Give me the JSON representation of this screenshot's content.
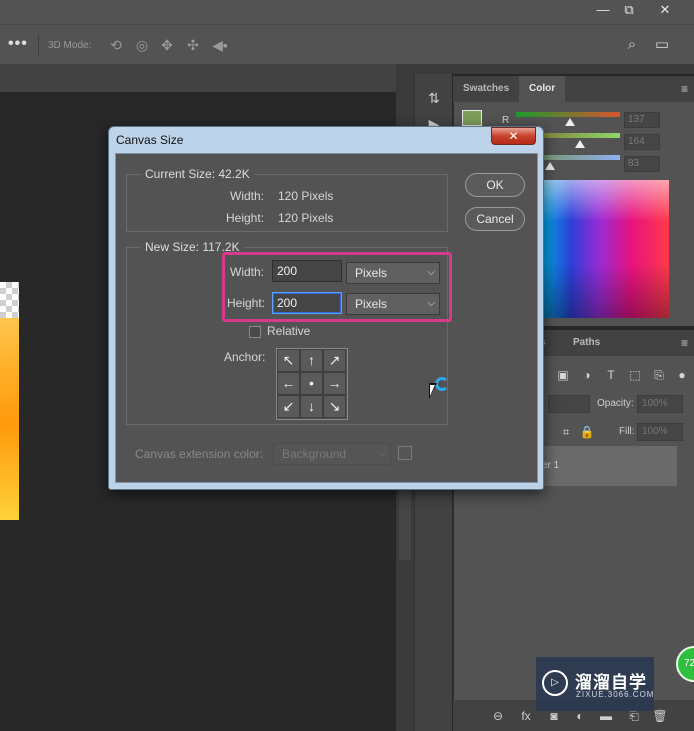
{
  "window_controls": {
    "minimize": "—",
    "restore": "⧉",
    "close": "✕"
  },
  "options_bar": {
    "more_label": "•••",
    "mode_label": "3D Mode:"
  },
  "panels": {
    "color_tabs": [
      "Swatches",
      "Color"
    ],
    "color": {
      "channel_r_label": "R",
      "r_value": "137",
      "g_value": "164",
      "b_value": "83",
      "foreground_color": "#7d9d5a"
    },
    "layers_tabs": [
      "ls",
      "Paths"
    ],
    "layers": {
      "opacity_label": "Opacity:",
      "opacity_value": "100%",
      "fill_label": "Fill:",
      "fill_value": "100%",
      "layer_name": "er 1"
    }
  },
  "watermark": {
    "title": "溜溜自学",
    "subtitle": "ZIXUE.3066.COM",
    "badge": "72"
  },
  "dialog": {
    "title": "Canvas Size",
    "close_label": "✕",
    "current_size": {
      "label": "Current Size: 42.2K",
      "width_label": "Width:",
      "width_value": "120 Pixels",
      "height_label": "Height:",
      "height_value": "120 Pixels"
    },
    "new_size": {
      "label": "New Size: 117.2K",
      "width_label": "Width:",
      "width_value": "200",
      "width_unit": "Pixels",
      "height_label": "Height:",
      "height_value": "200",
      "height_unit": "Pixels",
      "relative_label": "Relative",
      "relative_checked": false,
      "anchor_label": "Anchor:",
      "anchor_arrows": [
        "↖",
        "↑",
        "↗",
        "←",
        "•",
        "→",
        "↙",
        "↓",
        "↘"
      ]
    },
    "extension_color": {
      "label": "Canvas extension color:",
      "value": "Background"
    },
    "ok_label": "OK",
    "cancel_label": "Cancel"
  },
  "colors": {
    "highlight": "#d63a8b",
    "dialog_frame": "#bcd3ea",
    "close_button": "#c8432e"
  }
}
